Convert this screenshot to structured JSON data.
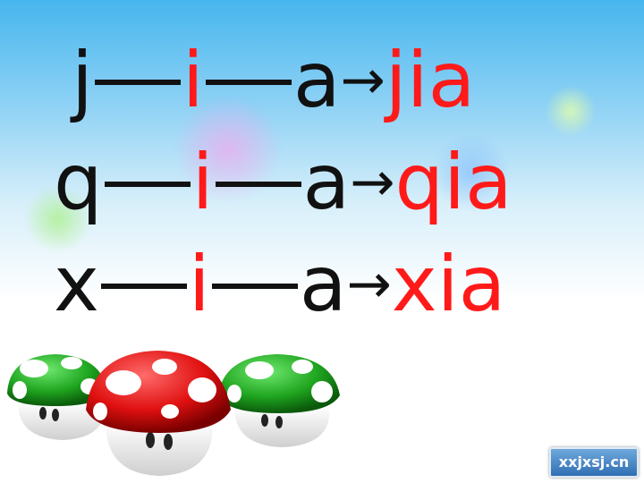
{
  "rows": [
    {
      "initial": "j",
      "medial": "i",
      "final": "a",
      "arrow": "→",
      "result": "jia"
    },
    {
      "initial": "q",
      "medial": "i",
      "final": "a",
      "arrow": "→",
      "result": "qia"
    },
    {
      "initial": "x",
      "medial": "i",
      "final": "a",
      "arrow": "→",
      "result": "xia"
    }
  ],
  "watermark": "xxjxsj.cn",
  "colors": {
    "highlight": "#ff1a1a",
    "text": "#111111"
  }
}
